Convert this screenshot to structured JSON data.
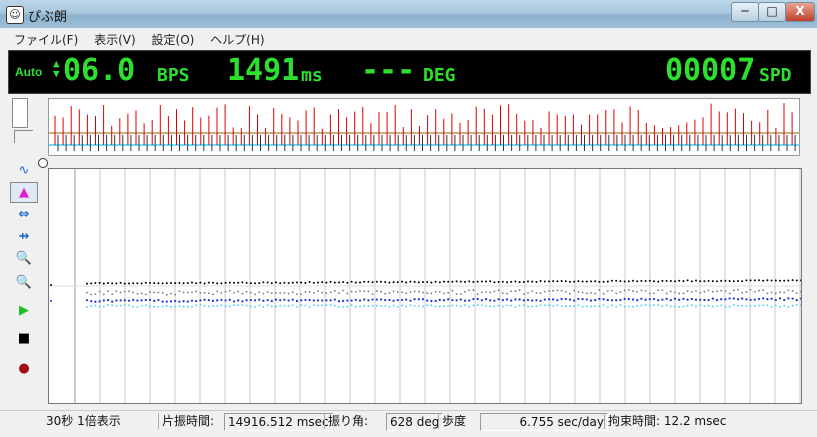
{
  "window": {
    "title": "ぴぶ朗",
    "icon": "app-face-icon"
  },
  "titlebar_buttons": {
    "minimize": "─",
    "maximize": "□",
    "close": "X"
  },
  "menu": [
    "ファイル(F)",
    "表示(V)",
    "設定(O)",
    "ヘルプ(H)"
  ],
  "lcd": {
    "auto": "Auto",
    "bps_value": "06.0",
    "bps_unit": "BPS",
    "ms_value": "1491",
    "ms_unit": "ms",
    "deg_value": "---",
    "deg_unit": "DEG",
    "spd_value": "00007",
    "spd_unit": "SPD",
    "color": "#2de02d"
  },
  "toolbar": [
    {
      "name": "wave-icon",
      "glyph": "∿"
    },
    {
      "name": "histogram-icon",
      "glyph": "▲"
    },
    {
      "name": "expand-horizontal-icon",
      "glyph": "⇔"
    },
    {
      "name": "shrink-horizontal-icon",
      "glyph": "⇸"
    },
    {
      "name": "zoom-in-icon",
      "glyph": "🔍"
    },
    {
      "name": "zoom-out-icon",
      "glyph": "🔍"
    },
    {
      "name": "play-icon",
      "glyph": "▶"
    },
    {
      "name": "stop-icon",
      "glyph": "■"
    },
    {
      "name": "record-icon",
      "glyph": "●"
    }
  ],
  "status": {
    "scale": "30秒 1倍表示",
    "half_period_label": "片振時間:",
    "half_period_value": "14916.512 msec",
    "amplitude_label": "振り角:",
    "amplitude_value": "628 deg",
    "rate_label": "歩度",
    "rate_value": "6.755 sec/day",
    "lock_label": "拘束時間: 12.2 msec"
  },
  "colors": {
    "strip_red": "#dd0000",
    "strip_cyan": "#66e0ff",
    "dot_black": "#000000",
    "dot_blue": "#1a33cc",
    "dot_cyan": "#33ccff"
  }
}
